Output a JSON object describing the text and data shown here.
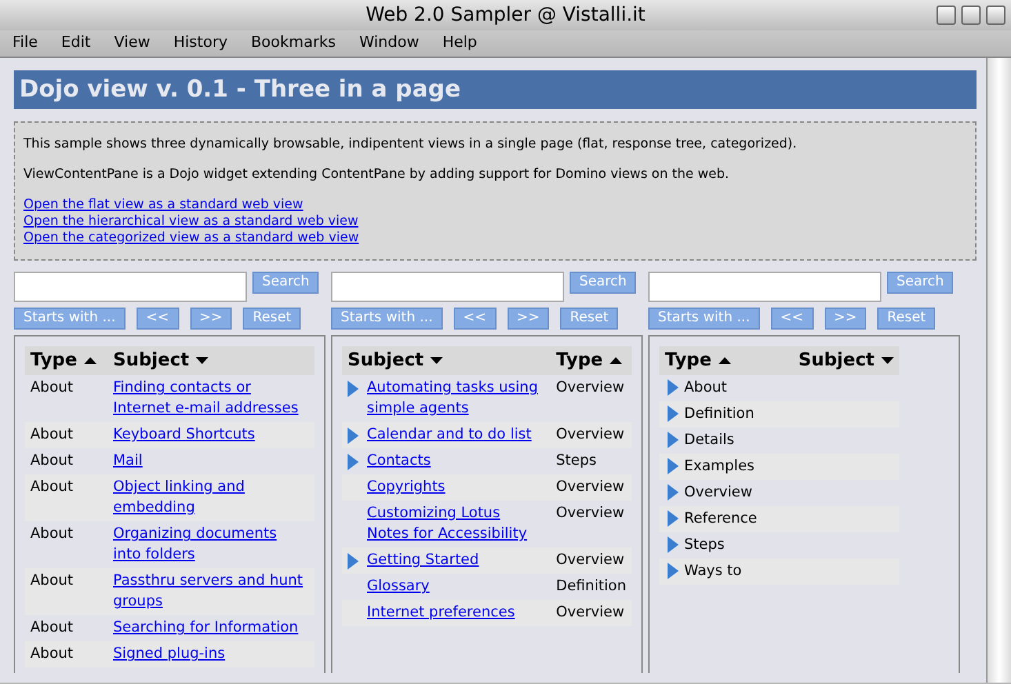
{
  "window": {
    "title": "Web 2.0 Sampler @ Vistalli.it"
  },
  "menu": [
    "File",
    "Edit",
    "View",
    "History",
    "Bookmarks",
    "Window",
    "Help"
  ],
  "page": {
    "heading": "Dojo view v. 0.1 - Three in a page",
    "intro": [
      "This sample shows three dynamically browsable, indipentent views in a single page (flat, response tree, categorized).",
      "ViewContentPane is a Dojo widget extending ContentPane by adding support for Domino views on the web."
    ],
    "links": [
      "Open the flat view as a standard web view",
      "Open the hierarchical view as a standard web view",
      "Open the categorized view as a standard web view"
    ]
  },
  "views": [
    {
      "search_button": "Search",
      "buttons": [
        "Starts with ...",
        "<<",
        ">>",
        "Reset"
      ],
      "columns": [
        {
          "label": "Type",
          "sort_ascending": true,
          "kind": "text"
        },
        {
          "label": "Subject",
          "sort_ascending": false,
          "kind": "link"
        }
      ],
      "rows": [
        {
          "cells": [
            "About",
            "Finding contacts or Internet e-mail addresses"
          ]
        },
        {
          "cells": [
            "About",
            "Keyboard Shortcuts"
          ]
        },
        {
          "cells": [
            "About",
            "Mail"
          ]
        },
        {
          "cells": [
            "About",
            "Object linking and embedding"
          ]
        },
        {
          "cells": [
            "About",
            "Organizing documents into folders"
          ]
        },
        {
          "cells": [
            "About",
            "Passthru servers and hunt groups"
          ]
        },
        {
          "cells": [
            "About",
            "Searching for Information"
          ]
        },
        {
          "cells": [
            "About",
            "Signed plug-ins"
          ]
        }
      ]
    },
    {
      "search_button": "Search",
      "buttons": [
        "Starts with ...",
        "<<",
        ">>",
        "Reset"
      ],
      "columns": [
        {
          "label": "Subject",
          "sort_ascending": false,
          "kind": "link"
        },
        {
          "label": "Type",
          "sort_ascending": true,
          "kind": "text"
        }
      ],
      "rows": [
        {
          "cells": [
            "Automating tasks using simple agents",
            "Overview"
          ],
          "expandable": true
        },
        {
          "cells": [
            "Calendar and to do list",
            "Overview"
          ],
          "expandable": true
        },
        {
          "cells": [
            "Contacts",
            "Steps"
          ],
          "expandable": true
        },
        {
          "cells": [
            "Copyrights",
            "Overview"
          ],
          "expandable": false
        },
        {
          "cells": [
            "Customizing Lotus Notes for Accessibility",
            "Overview"
          ],
          "expandable": false
        },
        {
          "cells": [
            "Getting Started",
            "Overview"
          ],
          "expandable": true
        },
        {
          "cells": [
            "Glossary",
            "Definition"
          ],
          "expandable": false
        },
        {
          "cells": [
            "Internet preferences",
            "Overview"
          ],
          "expandable": false
        }
      ]
    },
    {
      "search_button": "Search",
      "buttons": [
        "Starts with ...",
        "<<",
        ">>",
        "Reset"
      ],
      "columns": [
        {
          "label": "Type",
          "sort_ascending": true,
          "kind": "category"
        },
        {
          "label": "Subject",
          "sort_ascending": false,
          "kind": "empty"
        }
      ],
      "rows": [
        {
          "cells": [
            "About"
          ],
          "expandable": true
        },
        {
          "cells": [
            "Definition"
          ],
          "expandable": true
        },
        {
          "cells": [
            "Details"
          ],
          "expandable": true
        },
        {
          "cells": [
            "Examples"
          ],
          "expandable": true
        },
        {
          "cells": [
            "Overview"
          ],
          "expandable": true
        },
        {
          "cells": [
            "Reference"
          ],
          "expandable": true
        },
        {
          "cells": [
            "Steps"
          ],
          "expandable": true
        },
        {
          "cells": [
            "Ways to"
          ],
          "expandable": true
        }
      ]
    }
  ]
}
